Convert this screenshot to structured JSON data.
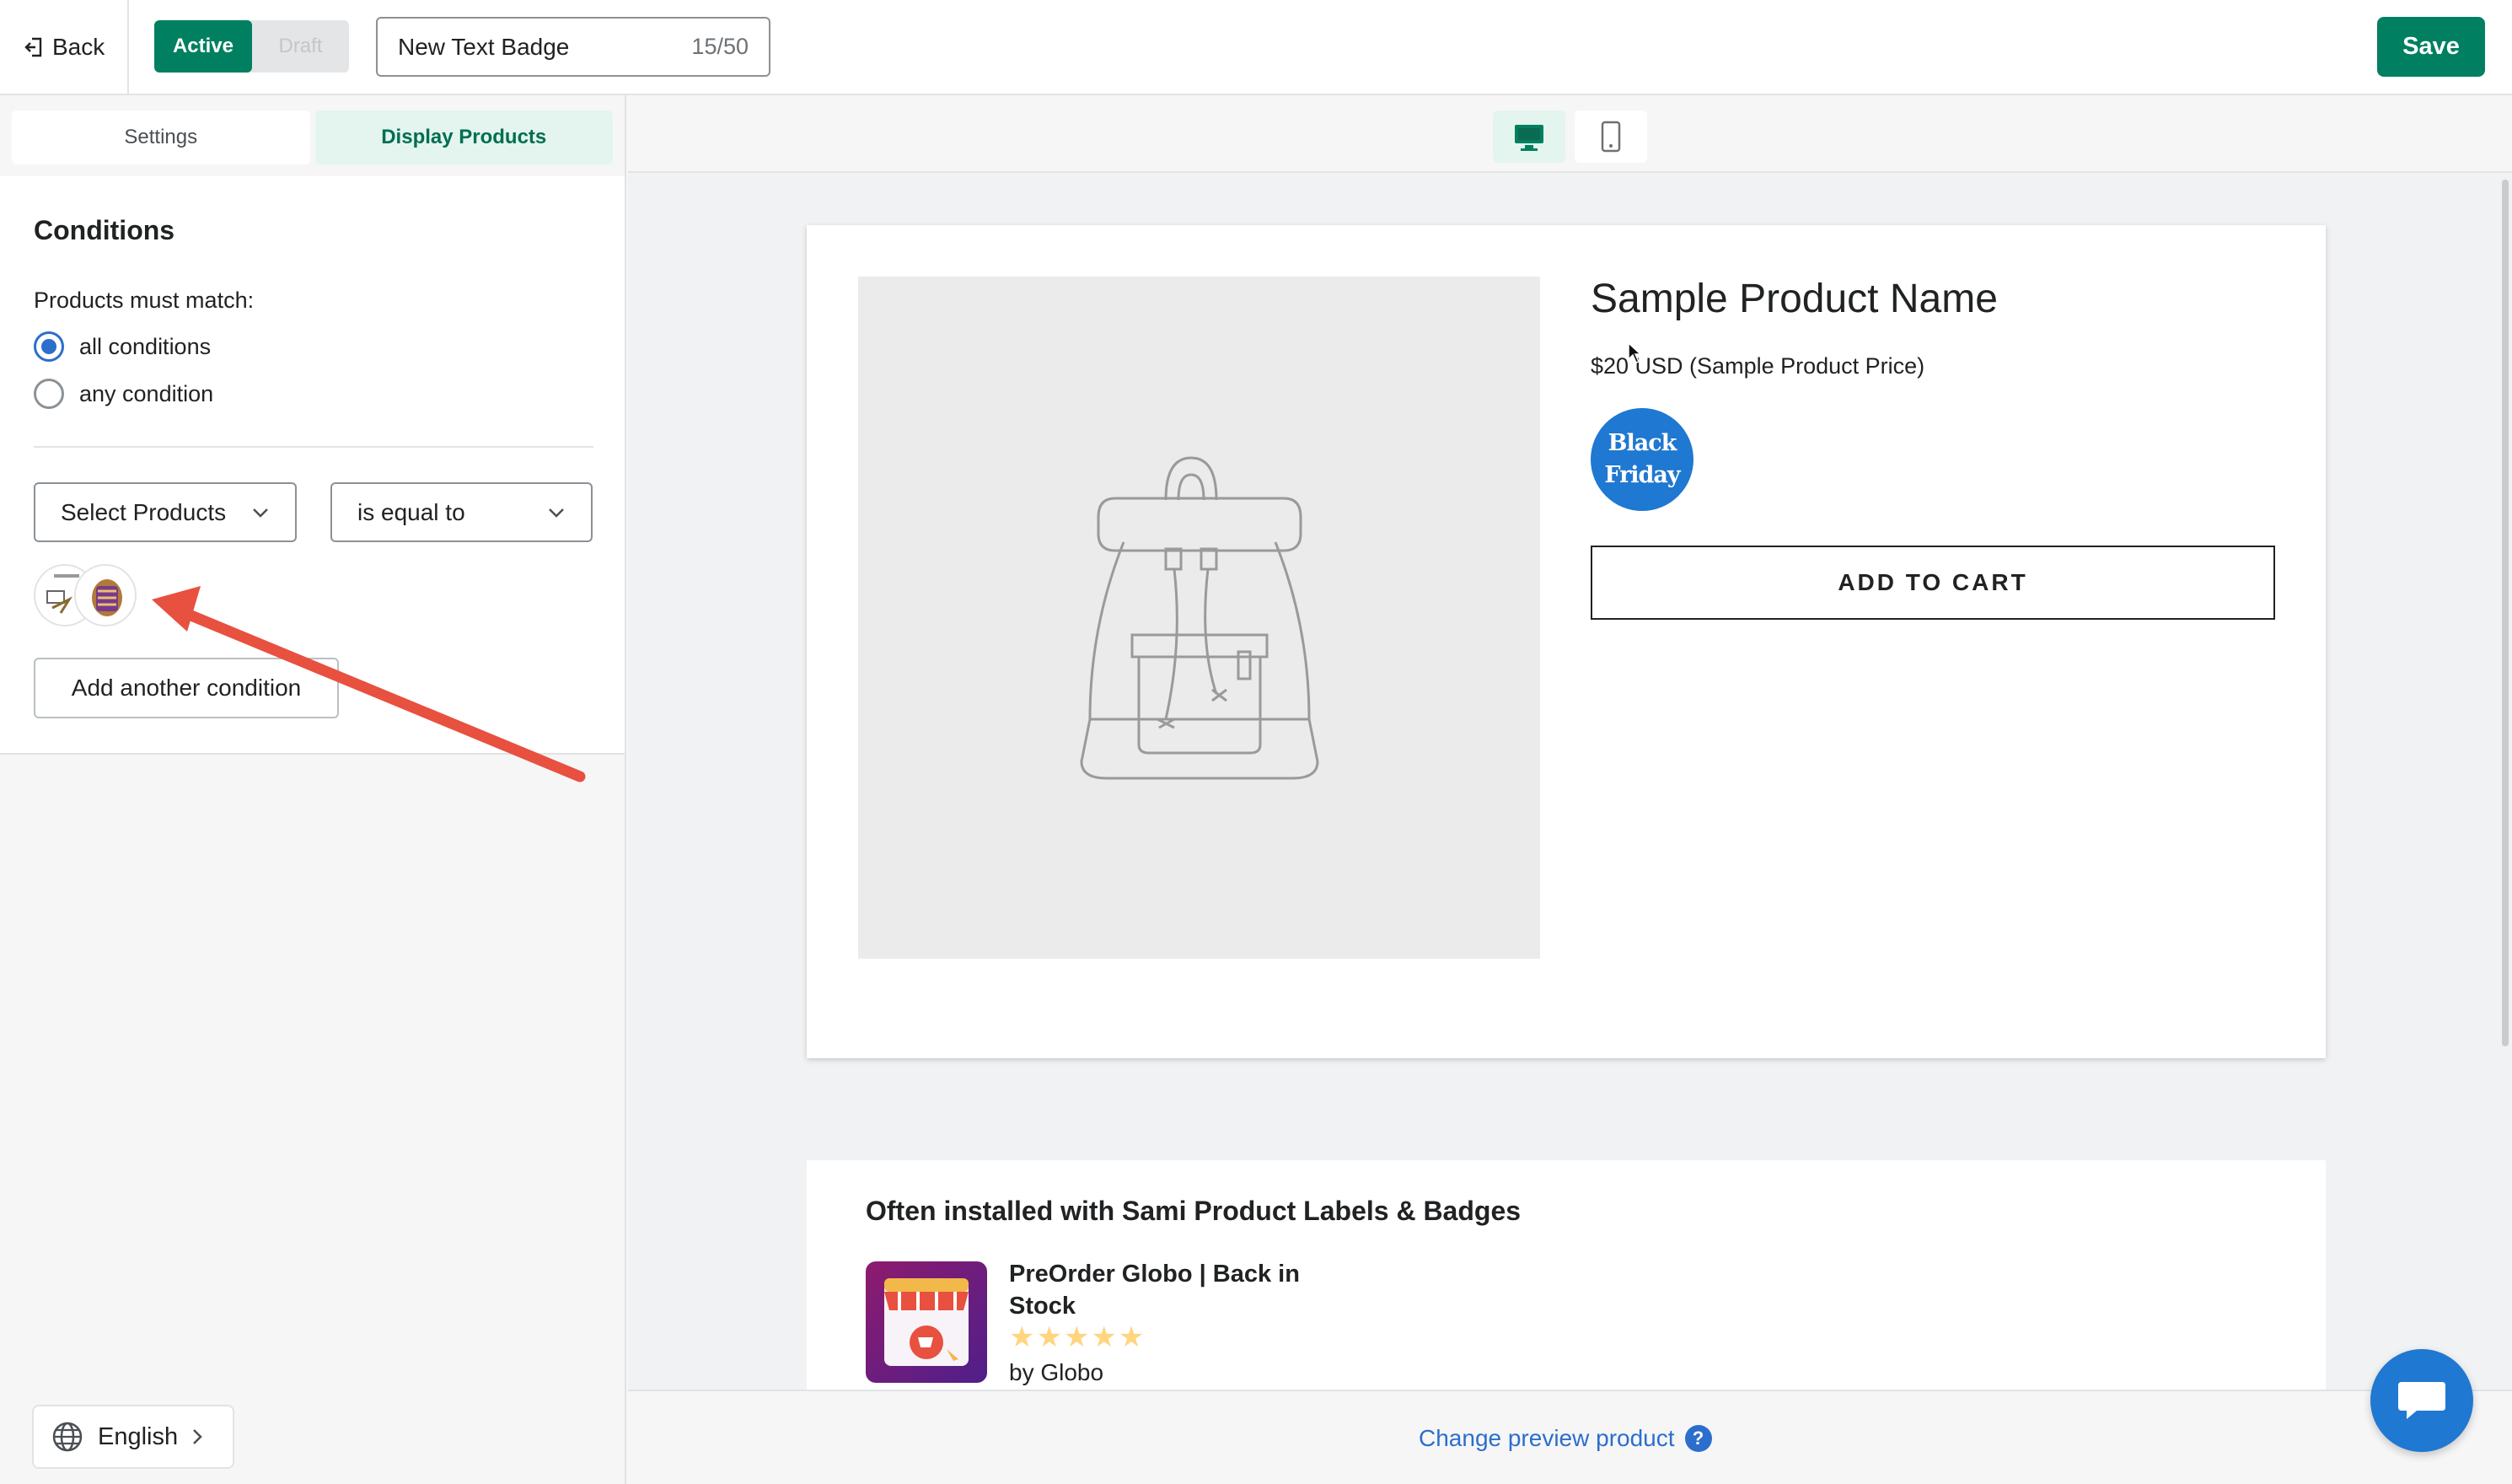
{
  "topbar": {
    "back_label": "Back",
    "status_active": "Active",
    "status_draft": "Draft",
    "badge_title_value": "New  Text Badge",
    "badge_title_count": "15/50",
    "save_label": "Save"
  },
  "left_panel": {
    "tabs": [
      {
        "label": "Settings",
        "active": false
      },
      {
        "label": "Display Products",
        "active": true
      }
    ],
    "conditions": {
      "title": "Conditions",
      "match_label": "Products must match:",
      "options": [
        {
          "label": "all conditions",
          "selected": true
        },
        {
          "label": "any condition",
          "selected": false
        }
      ],
      "field_select": "Select Products",
      "operator_select": "is equal to",
      "add_condition_label": "Add another condition"
    },
    "language_label": "English"
  },
  "preview": {
    "devices": [
      {
        "icon": "desktop-icon",
        "active": true
      },
      {
        "icon": "mobile-icon",
        "active": false
      }
    ],
    "product": {
      "name": "Sample Product Name",
      "price": "$20 USD (Sample Product Price)",
      "badge_line1": "Black",
      "badge_line2": "Friday",
      "cart_label": "ADD TO CART"
    },
    "recommendations": {
      "title": "Often installed with Sami Product Labels & Badges",
      "app_name": "PreOrder Globo | Back in Stock",
      "stars": "★★★★★",
      "rating": 5,
      "by": "by Globo"
    },
    "change_preview_label": "Change preview product"
  },
  "colors": {
    "primary": "#008060",
    "badge": "#1f78d1",
    "link": "#2c6ecb",
    "arrow": "#e8503f"
  }
}
